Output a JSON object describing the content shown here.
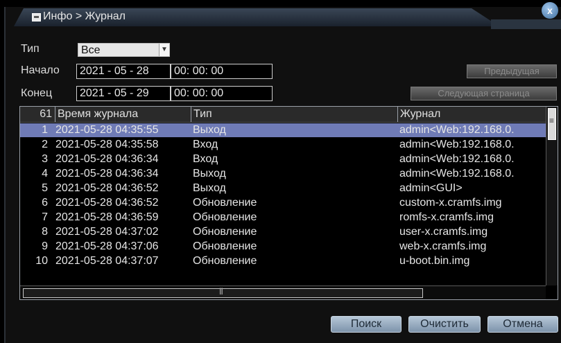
{
  "window": {
    "title": "Инфо > Журнал",
    "close_glyph": "x"
  },
  "filters": {
    "type_label": "Тип",
    "type_value": "Все",
    "start_label": "Начало",
    "start_date": "2021 - 05 - 28",
    "start_time": "00: 00: 00",
    "end_label": "Конец",
    "end_date": "2021 - 05 - 29",
    "end_time": "00: 00: 00",
    "prev_page_label": "Предыдущая",
    "next_page_label": "Следующая страница"
  },
  "table": {
    "headers": {
      "count": "61",
      "time": "Время журнала",
      "type": "Тип",
      "log": "Журнал"
    },
    "rows": [
      {
        "n": "1",
        "time": "2021-05-28 04:35:55",
        "type": "Выход",
        "log": "admin<Web:192.168.0."
      },
      {
        "n": "2",
        "time": "2021-05-28 04:35:58",
        "type": "Вход",
        "log": "admin<Web:192.168.0."
      },
      {
        "n": "3",
        "time": "2021-05-28 04:36:34",
        "type": "Вход",
        "log": "admin<Web:192.168.0."
      },
      {
        "n": "4",
        "time": "2021-05-28 04:36:34",
        "type": "Выход",
        "log": "admin<Web:192.168.0."
      },
      {
        "n": "5",
        "time": "2021-05-28 04:36:52",
        "type": "Выход",
        "log": "admin<GUI>"
      },
      {
        "n": "6",
        "time": "2021-05-28 04:36:52",
        "type": "Обновление",
        "log": "custom-x.cramfs.img"
      },
      {
        "n": "7",
        "time": "2021-05-28 04:36:59",
        "type": "Обновление",
        "log": "romfs-x.cramfs.img"
      },
      {
        "n": "8",
        "time": "2021-05-28 04:37:02",
        "type": "Обновление",
        "log": "user-x.cramfs.img"
      },
      {
        "n": "9",
        "time": "2021-05-28 04:37:06",
        "type": "Обновление",
        "log": "web-x.cramfs.img"
      },
      {
        "n": "10",
        "time": "2021-05-28 04:37:07",
        "type": "Обновление",
        "log": "u-boot.bin.img"
      }
    ]
  },
  "buttons": {
    "search": "Поиск",
    "clear": "Очистить",
    "cancel": "Отмена"
  },
  "colors": {
    "selected_row": "#6f7bb6",
    "button_blue": "#9fb2c6"
  }
}
